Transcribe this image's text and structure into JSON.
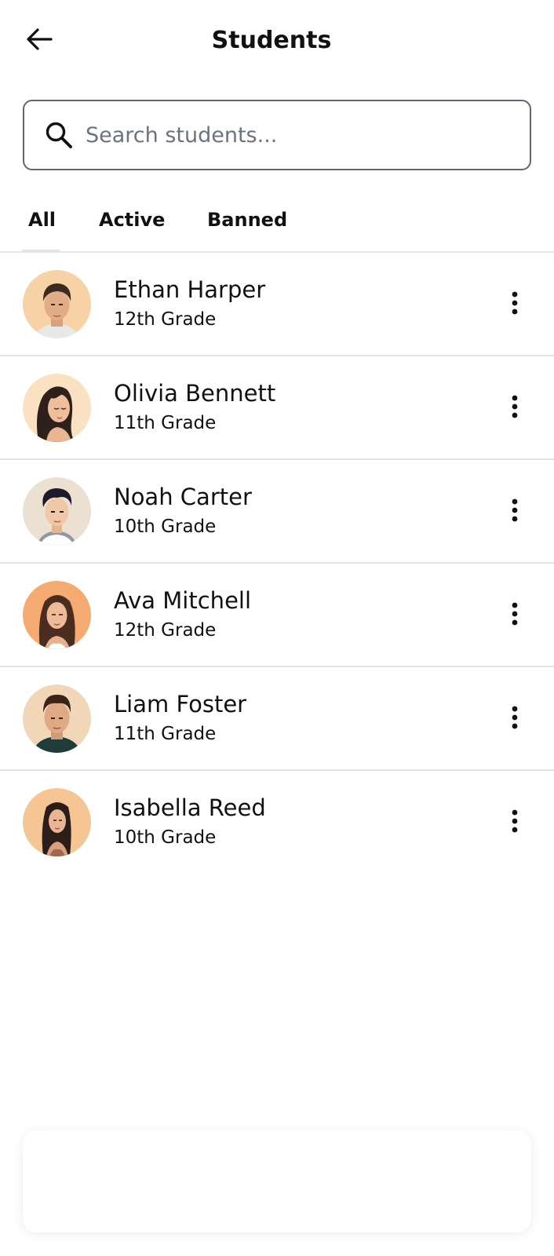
{
  "header": {
    "title": "Students",
    "back_icon": "arrow-left-icon"
  },
  "search": {
    "placeholder": "Search students...",
    "value": "",
    "icon": "search-icon"
  },
  "tabs": [
    {
      "label": "All",
      "selected": true
    },
    {
      "label": "Active",
      "selected": false
    },
    {
      "label": "Banned",
      "selected": false
    }
  ],
  "students": [
    {
      "name": "Ethan Harper",
      "grade": "12th Grade",
      "avatar_bg": "#f7d2a6"
    },
    {
      "name": "Olivia Bennett",
      "grade": "11th Grade",
      "avatar_bg": "#f9e1c2"
    },
    {
      "name": "Noah Carter",
      "grade": "10th Grade",
      "avatar_bg": "#ece0d2"
    },
    {
      "name": "Ava Mitchell",
      "grade": "12th Grade",
      "avatar_bg": "#f4aa70"
    },
    {
      "name": "Liam Foster",
      "grade": "11th Grade",
      "avatar_bg": "#f2d6b8"
    },
    {
      "name": "Isabella Reed",
      "grade": "10th Grade",
      "avatar_bg": "#f6c594"
    }
  ],
  "row_actions_icon": "more-vertical-icon",
  "colors": {
    "text": "#111111",
    "placeholder": "#6b7280",
    "border": "#5f6670",
    "divider": "#e3e4e7"
  }
}
